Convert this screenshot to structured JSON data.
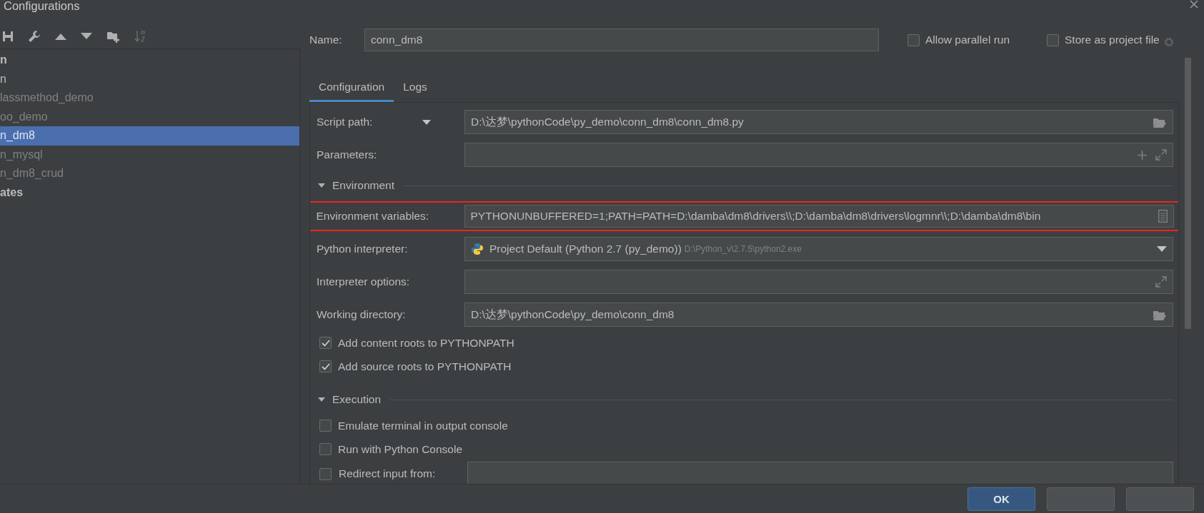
{
  "window": {
    "title": "Configurations"
  },
  "sidebar": {
    "items": [
      {
        "label": "n",
        "kind": "group",
        "selected": false
      },
      {
        "label": "n",
        "kind": "item",
        "selected": false
      },
      {
        "label": "lassmethod_demo",
        "kind": "item-dim",
        "selected": false
      },
      {
        "label": "oo_demo",
        "kind": "item-dim",
        "selected": false
      },
      {
        "label": "n_dm8",
        "kind": "item",
        "selected": true
      },
      {
        "label": "n_mysql",
        "kind": "item-dim",
        "selected": false
      },
      {
        "label": "n_dm8_crud",
        "kind": "item-dim",
        "selected": false
      },
      {
        "label": "ates",
        "kind": "group",
        "selected": false
      }
    ]
  },
  "name_field": {
    "label": "Name:",
    "value": "conn_dm8"
  },
  "options": [
    {
      "label": "Allow parallel run",
      "checked": false
    },
    {
      "label": "Store as project file",
      "checked": false
    }
  ],
  "tabs": [
    {
      "label": "Configuration",
      "selected": true
    },
    {
      "label": "Logs",
      "selected": false
    }
  ],
  "form": [
    {
      "kind": "file-path",
      "label": "Script path:",
      "value": "D:\\达梦\\pythonCode\\py_demo\\conn_dm8\\conn_dm8.py",
      "highlighted": false
    },
    {
      "kind": "text-list",
      "label": "Parameters:",
      "highlighted": false
    },
    {
      "kind": "section",
      "label": "Environment",
      "expanded": true
    },
    {
      "kind": "env",
      "label": "Environment variables:",
      "value": "PYTHONUNBUFFERED=1;PATH=PATH=D:\\damba\\dm8\\drivers\\\\;D:\\damba\\dm8\\drivers\\logmnr\\\\;D:\\damba\\dm8\\bin",
      "highlighted": true
    },
    {
      "kind": "select",
      "label": "Python interpreter:",
      "value": "Project Default (Python 2.7 (py_demo))",
      "hint": "D:\\Python_v\\2.7.5\\python2.exe",
      "highlighted": false
    },
    {
      "kind": "text-expand",
      "label": "Interpreter options:",
      "highlighted": false
    },
    {
      "kind": "dir-path",
      "label": "Working directory:",
      "value": "D:\\达梦\\pythonCode\\py_demo\\conn_dm8",
      "highlighted": false
    },
    {
      "kind": "checkbox",
      "label": "Add content roots to PYTHONPATH",
      "checked": true
    },
    {
      "kind": "checkbox",
      "label": "Add source roots to PYTHONPATH",
      "checked": true
    },
    {
      "kind": "section",
      "label": "Execution",
      "expanded": true
    },
    {
      "kind": "checkbox",
      "label": "Emulate terminal in output console",
      "checked": false
    },
    {
      "kind": "checkbox",
      "label": "Run with Python Console",
      "checked": false
    },
    {
      "kind": "redirect",
      "label": "Redirect input from:",
      "checked": false
    }
  ],
  "buttons": [
    {
      "kind": "default",
      "label": "OK"
    },
    {
      "kind": "plain"
    },
    {
      "kind": "plain"
    }
  ]
}
